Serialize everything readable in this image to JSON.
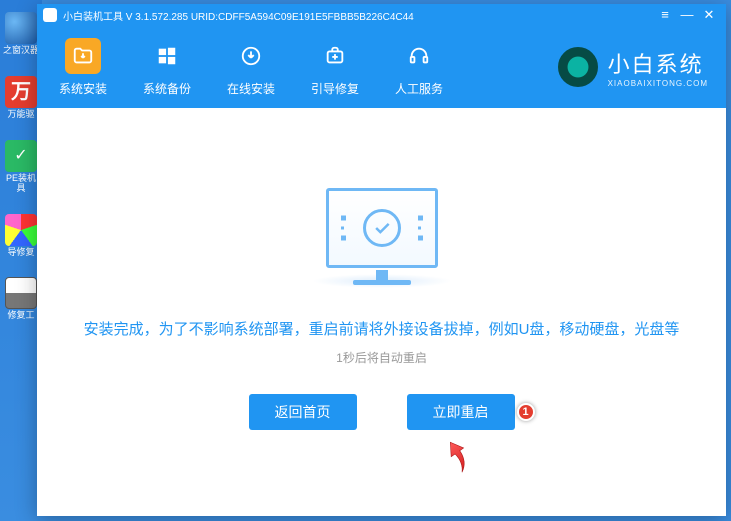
{
  "desktop": {
    "items": [
      {
        "label": "之窗汉器"
      },
      {
        "label": "万能驱"
      },
      {
        "label": "PE装机具"
      },
      {
        "label": "导修复"
      },
      {
        "label": "修复工"
      }
    ]
  },
  "titlebar": {
    "title": "小白装机工具 V 3.1.572.285 URID:CDFF5A594C09E191E5FBBB5B226C4C44"
  },
  "nav": {
    "items": [
      {
        "label": "系统安装",
        "icon": "folder-down"
      },
      {
        "label": "系统备份",
        "icon": "windows"
      },
      {
        "label": "在线安装",
        "icon": "download"
      },
      {
        "label": "引导修复",
        "icon": "medkit"
      },
      {
        "label": "人工服务",
        "icon": "headset"
      }
    ]
  },
  "brand": {
    "name": "小白系统",
    "url": "XIAOBAIXITONG.COM"
  },
  "content": {
    "primary": "安装完成，为了不影响系统部署，重启前请将外接设备拔掉，例如U盘，移动硬盘，光盘等",
    "secondary": "1秒后将自动重启",
    "buttons": {
      "back": "返回首页",
      "restart": "立即重启"
    },
    "badge": "1"
  }
}
